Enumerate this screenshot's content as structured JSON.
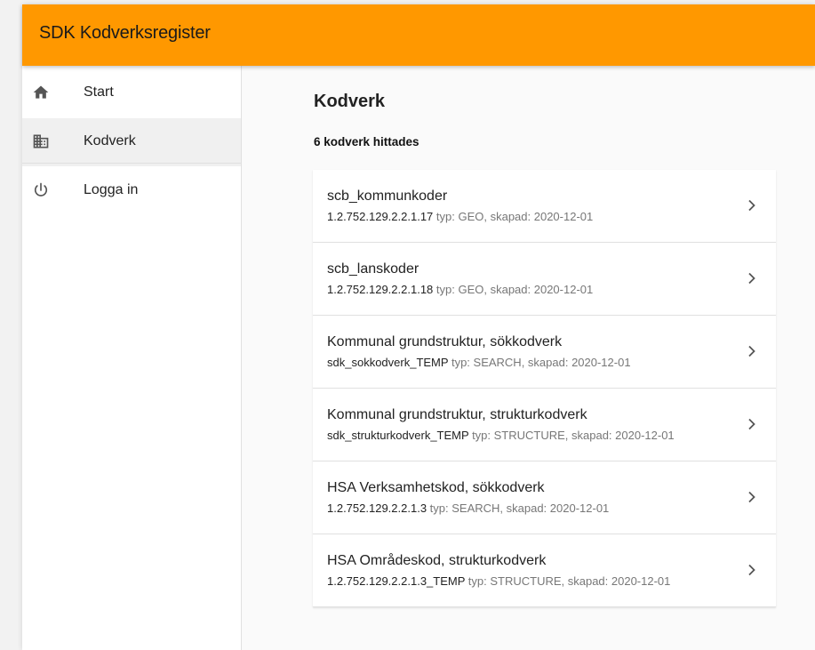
{
  "app": {
    "title": "SDK Kodverksregister"
  },
  "sidebar": {
    "items": [
      {
        "label": "Start",
        "icon": "home-icon"
      },
      {
        "label": "Kodverk",
        "icon": "building-icon",
        "active": true
      },
      {
        "label": "Logga in",
        "icon": "power-icon"
      }
    ]
  },
  "main": {
    "title": "Kodverk",
    "result_count": "6 kodverk hittades",
    "items": [
      {
        "name": "scb_kommunkoder",
        "id": "1.2.752.129.2.2.1.17",
        "meta": "typ: GEO, skapad: 2020-12-01"
      },
      {
        "name": "scb_lanskoder",
        "id": "1.2.752.129.2.2.1.18",
        "meta": "typ: GEO, skapad: 2020-12-01"
      },
      {
        "name": "Kommunal grundstruktur, sökkodverk",
        "id": "sdk_sokkodverk_TEMP",
        "meta": "typ: SEARCH, skapad: 2020-12-01"
      },
      {
        "name": "Kommunal grundstruktur, strukturkodverk",
        "id": "sdk_strukturkodverk_TEMP",
        "meta": "typ: STRUCTURE, skapad: 2020-12-01"
      },
      {
        "name": "HSA Verksamhetskod, sökkodverk",
        "id": "1.2.752.129.2.2.1.3",
        "meta": "typ: SEARCH, skapad: 2020-12-01"
      },
      {
        "name": "HSA Områdeskod, strukturkodverk",
        "id": "1.2.752.129.2.2.1.3_TEMP",
        "meta": "typ: STRUCTURE, skapad: 2020-12-01"
      }
    ]
  },
  "colors": {
    "appbar": "#ff9800",
    "active_nav": "#f0f0f0",
    "meta_text": "#777777"
  }
}
